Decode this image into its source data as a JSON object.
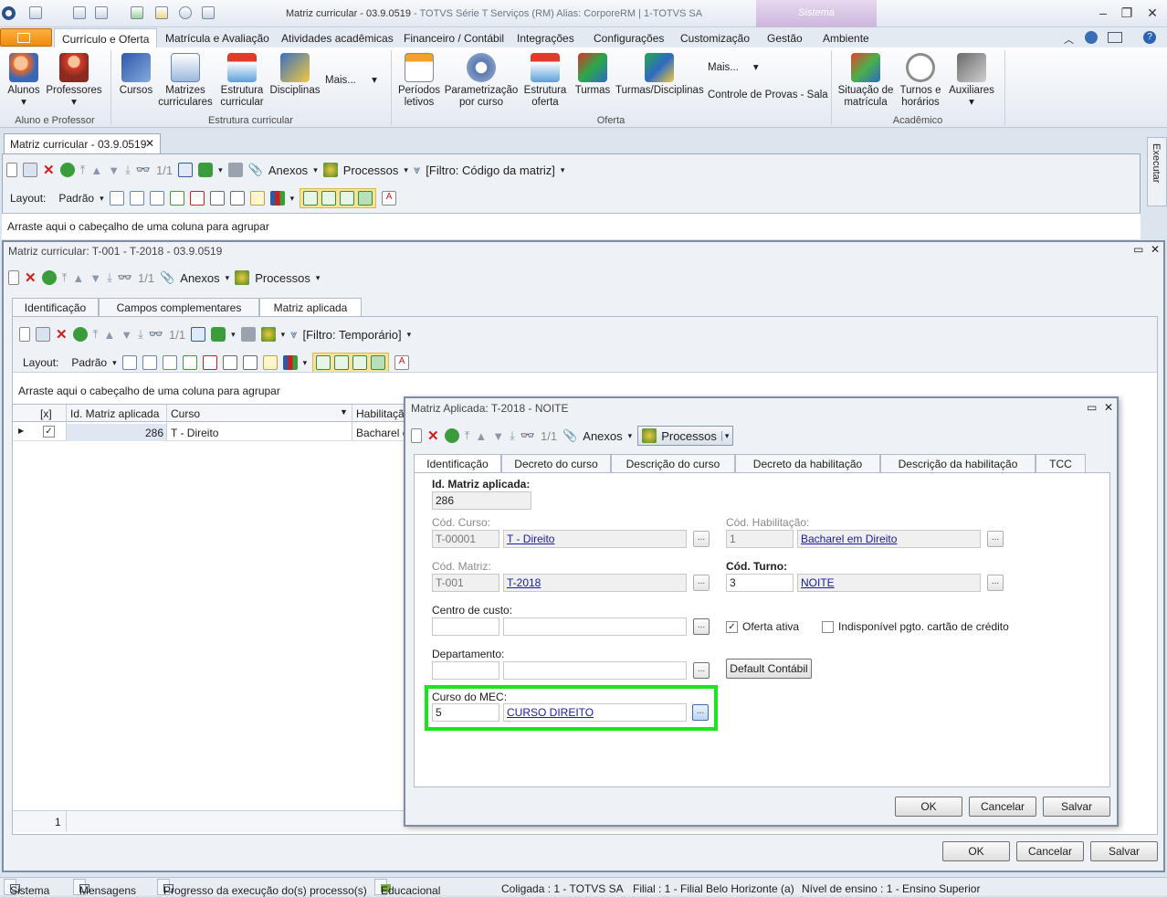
{
  "window": {
    "title": "Matriz curricular - 03.9.0519",
    "title_suffix": " - TOTVS Série T Serviços (RM) Alias: CorporeRM | 1-TOTVS SA",
    "system_tab": "Sistema"
  },
  "menu": [
    "Currículo e Oferta",
    "Matrícula e Avaliação",
    "Atividades acadêmicas",
    "Financeiro / Contábil",
    "Integrações",
    "Configurações",
    "Customização",
    "Gestão",
    "Ambiente"
  ],
  "ribbon": {
    "g1": {
      "items": [
        "Alunos",
        "Professores"
      ],
      "label": "Aluno e Professor"
    },
    "g2": {
      "items": [
        "Cursos",
        "Matrizes curriculares",
        "Estrutura curricular",
        "Disciplinas"
      ],
      "mais": "Mais...",
      "label": "Estrutura curricular"
    },
    "g3": {
      "items": [
        "Períodos letivos",
        "Parametrização por curso",
        "Estrutura oferta",
        "Turmas",
        "Turmas/Disciplinas"
      ],
      "mais": "Mais...",
      "extra": "Controle de Provas - Sala",
      "label": "Oferta"
    },
    "g4": {
      "items": [
        "Situação de matrícula",
        "Turnos e horários",
        "Auxiliares"
      ],
      "label": "Acadêmico"
    }
  },
  "doc_tab": "Matriz curricular - 03.9.0519",
  "executar": "Executar",
  "outer": {
    "page": "1/1",
    "anexos": "Anexos",
    "processos": "Processos",
    "filtro": "[Filtro: Código da matriz]",
    "layout": "Layout:",
    "padrao": "Padrão",
    "group_hint": "Arraste aqui o cabeçalho de uma coluna para agrupar"
  },
  "mid": {
    "title": "Matriz curricular: T-001 - T-2018 - 03.9.0519",
    "page": "1/1",
    "anexos": "Anexos",
    "processos": "Processos",
    "tabs": [
      "Identificação",
      "Campos complementares",
      "Matriz aplicada"
    ],
    "filtro": "[Filtro: Temporário]",
    "layout": "Layout:",
    "padrao": "Padrão",
    "group_hint": "Arraste aqui o cabeçalho de uma coluna para agrupar",
    "cols": [
      "[x]",
      "Id. Matriz aplicada",
      "Curso",
      "Habilitação"
    ],
    "row": {
      "id": "286",
      "curso": "T - Direito",
      "hab": "Bacharel em"
    },
    "footer_count": "1",
    "buttons": {
      "ok": "OK",
      "cancel": "Cancelar",
      "save": "Salvar"
    }
  },
  "dialog": {
    "title": "Matriz Aplicada: T-2018 - NOITE",
    "page": "1/1",
    "anexos": "Anexos",
    "processos": "Processos",
    "tabs": [
      "Identificação",
      "Decreto do curso",
      "Descrição do curso",
      "Decreto da habilitação",
      "Descrição da habilitação",
      "TCC"
    ],
    "id_label": "Id. Matriz aplicada:",
    "id_value": "286",
    "curso_label": "Cód. Curso:",
    "curso_code": "T-00001",
    "curso_name": "T - Direito",
    "hab_label": "Cód. Habilitação:",
    "hab_code": "1",
    "hab_name": "Bacharel em Direito",
    "matriz_label": "Cód. Matriz:",
    "matriz_code": "T-001",
    "matriz_name": "T-2018",
    "turno_label": "Cód. Turno:",
    "turno_code": "3",
    "turno_name": "NOITE",
    "cc_label": "Centro de custo:",
    "oferta_ativa": "Oferta ativa",
    "indisp": "Indisponível pgto. cartão de crédito",
    "dep_label": "Departamento:",
    "default_contabil": "Default Contábil",
    "mec_label": "Curso do MEC:",
    "mec_code": "5",
    "mec_name": "CURSO DIREITO",
    "buttons": {
      "ok": "OK",
      "cancel": "Cancelar",
      "save": "Salvar"
    }
  },
  "status": {
    "sistema": "Sistema",
    "mensagens": "Mensagens",
    "progresso": "Progresso da execução do(s) processo(s)",
    "educacional": "Educacional",
    "coligada": "Coligada : 1 - TOTVS SA",
    "filial": "Filial : 1 - Filial Belo Horizonte (a)",
    "nivel": "Nível de ensino : 1 - Ensino Superior"
  },
  "colors": {
    "highlight": "#19e619",
    "ribbon_active": "#f18a0f"
  }
}
